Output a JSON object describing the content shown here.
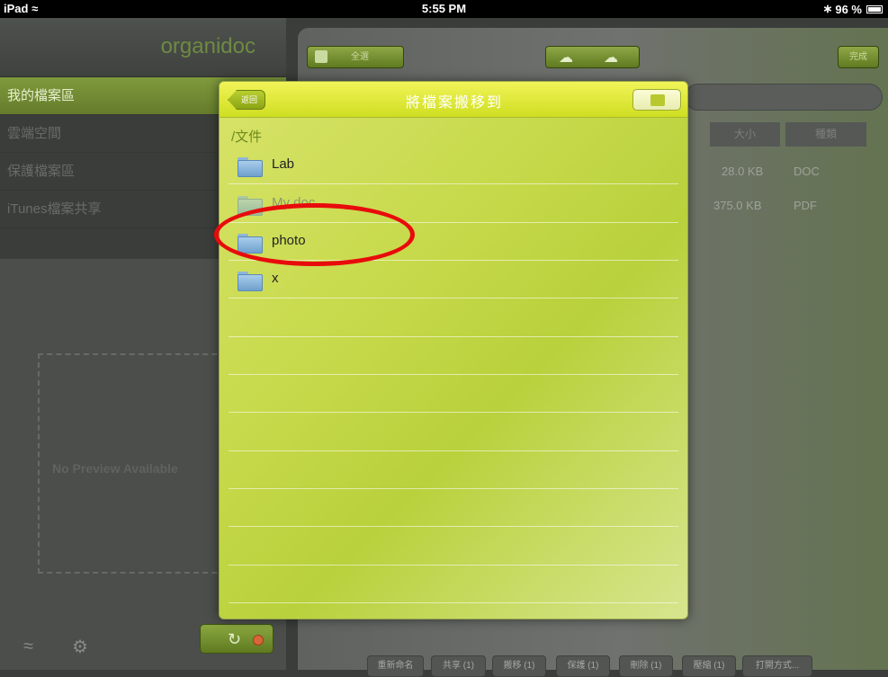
{
  "status_bar": {
    "device": "iPad",
    "wifi_icon": "wifi-icon",
    "time": "5:55 PM",
    "bluetooth_icon": "bluetooth-icon",
    "battery": "96 %"
  },
  "sidebar": {
    "logo": "organidoc",
    "menu": [
      {
        "label": "我的檔案區",
        "active": true
      },
      {
        "label": "雲端空間",
        "active": false
      },
      {
        "label": "保護檔案區",
        "active": false
      },
      {
        "label": "iTunes檔案共享",
        "active": false
      }
    ],
    "preview_text": "No Preview Available"
  },
  "main": {
    "toolbar": {
      "select_all": "全選",
      "done": "完成"
    },
    "columns": [
      "大小",
      "種類"
    ],
    "files": [
      {
        "size": "28.0 KB",
        "type": "DOC"
      },
      {
        "size": "375.0 KB",
        "type": "PDF"
      }
    ],
    "bottom_buttons": [
      "重新命名",
      "共享 (1)",
      "搬移 (1)",
      "保護 (1)",
      "刪除 (1)",
      "壓縮 (1)",
      "打開方式..."
    ]
  },
  "popup": {
    "title": "將檔案搬移到",
    "back_label": "返回",
    "path": "/文件",
    "folders": [
      {
        "name": "Lab",
        "dimmed": false
      },
      {
        "name": "My doc",
        "dimmed": true
      },
      {
        "name": "photo",
        "dimmed": false
      },
      {
        "name": "x",
        "dimmed": false
      }
    ]
  },
  "colors": {
    "accent_green": "#7f9a3c",
    "highlight_red": "#e80b0b",
    "popup_yellow": "#cfde22"
  }
}
